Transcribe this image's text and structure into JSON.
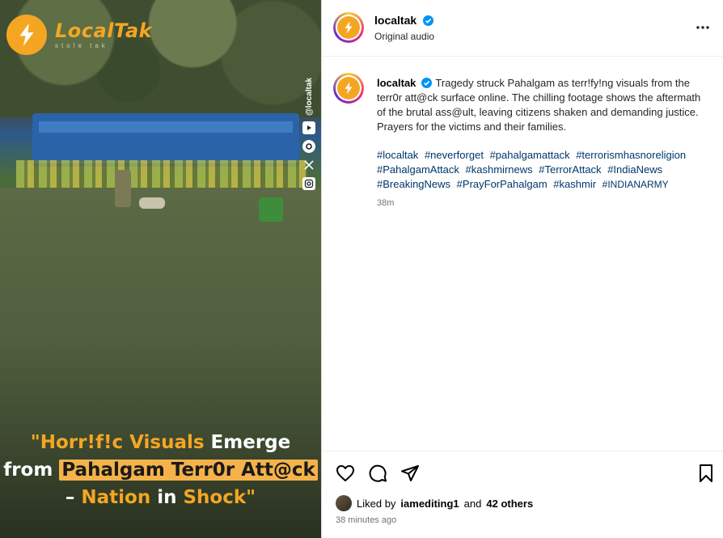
{
  "media": {
    "brand_name": "LocalTak",
    "brand_tagline": "stole tak",
    "social_handle": "@localtak",
    "headline": {
      "line1_a": "\"Horr!f!c Visuals",
      "line1_b": " Emerge",
      "line2_a": "from ",
      "line2_box": "Pahalgam Terr0r Att@ck",
      "line3_a": "– ",
      "line3_b": "Nation",
      "line3_c": " in ",
      "line3_d": "Shock\""
    }
  },
  "post": {
    "username": "localtak",
    "audio": "Original audio",
    "caption": "Tragedy struck Pahalgam as terr!fy!ng visuals from the terr0r att@ck surface online. The chilling footage shows the aftermath of the brutal ass@ult, leaving citizens shaken and demanding justice. Prayers for the victims and their families.",
    "hashtags": [
      "#localtak",
      "#neverforget",
      "#pahalgamattack",
      "#terrorismhasnoreligion",
      "#PahalgamAttack",
      "#kashmirnews",
      "#TerrorAttack",
      "#IndiaNews",
      "#BreakingNews",
      "#PrayForPahalgam",
      "#kashmir",
      "#INDIANARMY"
    ],
    "caption_time": "38m",
    "liked_by_prefix": "Liked by",
    "liked_by_user": "iamediting1",
    "liked_by_and": "and",
    "liked_by_others": "42 others",
    "post_time": "38 minutes ago"
  },
  "colors": {
    "brand": "#f4a623",
    "hashtag": "#00376b",
    "verified": "#0095f6"
  },
  "icons": [
    "logo-bolt-icon",
    "youtube-icon",
    "threads-icon",
    "x-icon",
    "instagram-icon",
    "verified-icon",
    "more-options-icon",
    "heart-icon",
    "comment-icon",
    "share-icon",
    "bookmark-icon"
  ]
}
